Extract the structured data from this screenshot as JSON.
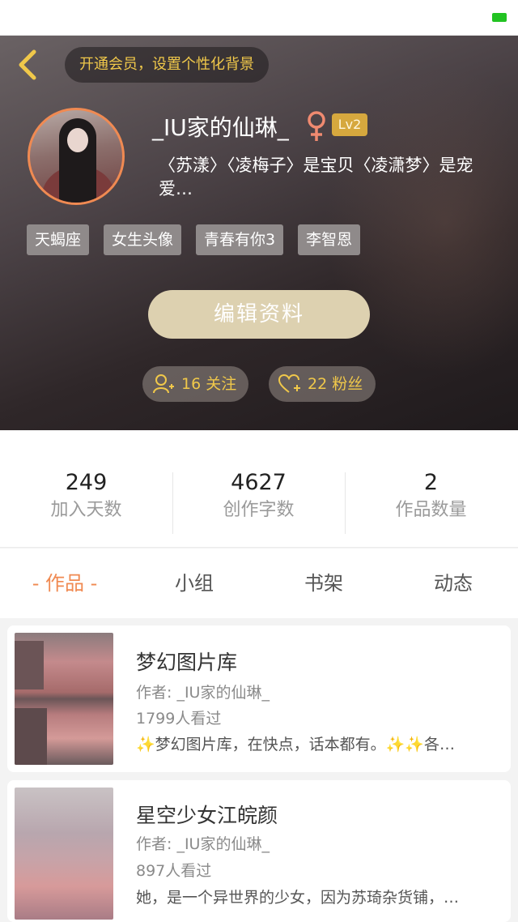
{
  "header": {
    "vip_prompt": "开通会员，设置个性化背景",
    "username": "_IU家的仙琳_",
    "level": "Lv2",
    "bio": "〈苏漾〉〈凌梅子〉是宝贝〈凌潇梦〉是宠爱…",
    "tags": [
      "天蝎座",
      "女生头像",
      "青春有你3",
      "李智恩"
    ],
    "edit_button": "编辑资料",
    "following_label": "16 关注",
    "fans_label": "22 粉丝"
  },
  "stats": [
    {
      "value": "249",
      "label": "加入天数"
    },
    {
      "value": "4627",
      "label": "创作字数"
    },
    {
      "value": "2",
      "label": "作品数量"
    }
  ],
  "tabs": [
    "- 作品 -",
    "小组",
    "书架",
    "动态"
  ],
  "works": [
    {
      "title": "梦幻图片库",
      "author": "作者: _IU家的仙琳_",
      "views": "1799人看过",
      "description": "✨梦幻图片库，在快点，话本都有。✨✨各…"
    },
    {
      "title": "星空少女江皖颜",
      "author": "作者: _IU家的仙琳_",
      "views": "897人看过",
      "description": "她，是一个异世界的少女，因为苏琦杂货铺，…"
    }
  ],
  "colors": {
    "accent": "#f08a52",
    "gold": "#f0c84a",
    "edit_button": "#ddd1b0",
    "battery": "#22c322"
  }
}
